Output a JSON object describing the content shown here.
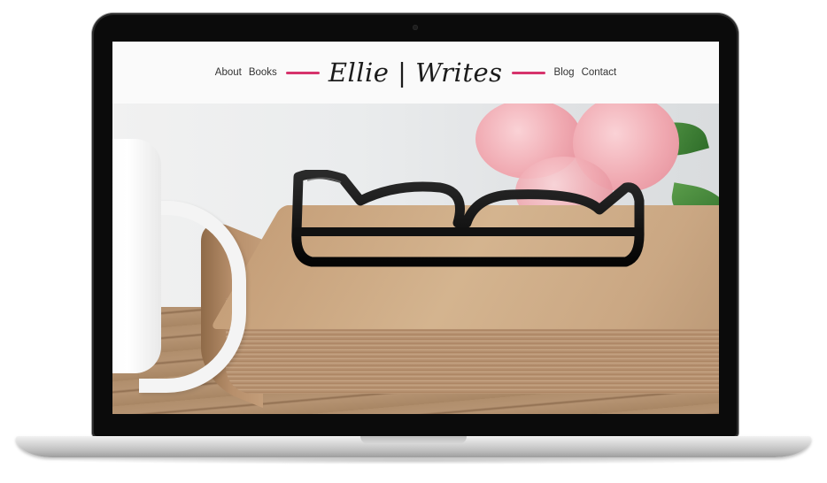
{
  "site": {
    "nav_left": [
      "About",
      "Books"
    ],
    "logo": "Ellie | Writes",
    "nav_right": [
      "Blog",
      "Contact"
    ],
    "accent_color": "#d6336c"
  },
  "hero": {
    "image_alt": "Glasses on an old book with a white mug and pink roses"
  }
}
